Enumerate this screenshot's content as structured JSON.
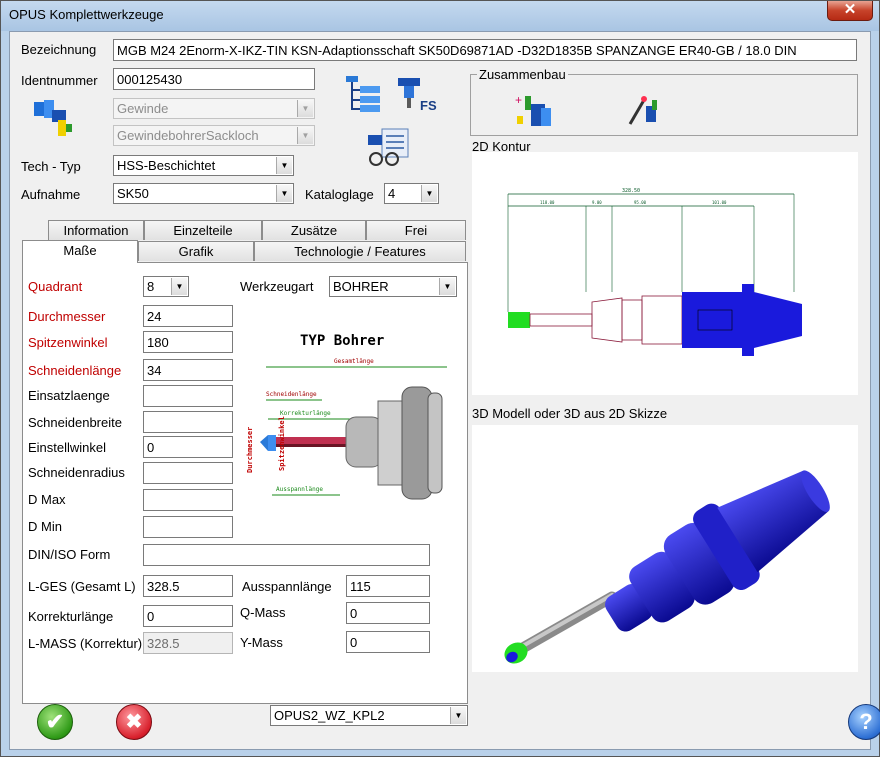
{
  "window": {
    "title": "OPUS Komplettwerkzeuge",
    "close_label": "✕"
  },
  "header": {
    "bezeichnung_label": "Bezeichnung",
    "bezeichnung_value": "MGB M24 2Enorm-X-IKZ-TIN KSN-Adaptionsschaft SK50D69871AD -D32D1835B SPANZANGE ER40-GB / 18.0 DIN",
    "identnummer_label": "Identnummer",
    "identnummer_value": "000125430",
    "gewinde_value": "Gewinde",
    "gewindebohrer_value": "GewindebohrerSackloch",
    "tech_typ_label": "Tech - Typ",
    "tech_typ_value": "HSS-Beschichtet",
    "aufnahme_label": "Aufnahme",
    "aufnahme_value": "SK50",
    "kataloglage_label": "Kataloglage",
    "kataloglage_value": "4"
  },
  "tabs": {
    "row1": [
      "Information",
      "Einzelteile",
      "Zusätze",
      "Frei"
    ],
    "row2": [
      "Maße",
      "Grafik",
      "Technologie / Features"
    ],
    "active": "Maße"
  },
  "masse": {
    "quadrant_label": "Quadrant",
    "quadrant_value": "8",
    "werkzeugart_label": "Werkzeugart",
    "werkzeugart_value": "BOHRER",
    "durchmesser_label": "Durchmesser",
    "durchmesser_value": "24",
    "spitzenwinkel_label": "Spitzenwinkel",
    "spitzenwinkel_value": "180",
    "schneidenlaenge_label": "Schneidenlänge",
    "schneidenlaenge_value": "34",
    "einsatzlaenge_label": "Einsatzlaenge",
    "einsatzlaenge_value": "",
    "schneidenbreite_label": "Schneidenbreite",
    "schneidenbreite_value": "",
    "einstellwinkel_label": "Einstellwinkel",
    "einstellwinkel_value": "0",
    "schneidenradius_label": "Schneidenradius",
    "schneidenradius_value": "",
    "dmax_label": "D Max",
    "dmax_value": "",
    "dmin_label": "D Min",
    "dmin_value": "",
    "diniso_label": "DIN/ISO Form",
    "diniso_value": "",
    "lges_label": "L-GES (Gesamt L)",
    "lges_value": "328.5",
    "ausspann_label": "Ausspannlänge",
    "ausspann_value": "115",
    "korrektur_label": "Korrekturlänge",
    "korrektur_value": "0",
    "qmass_label": "Q-Mass",
    "qmass_value": "0",
    "lmass_label": "L-MASS (Korrektur)",
    "lmass_value": "328.5",
    "ymass_label": "Y-Mass",
    "ymass_value": "0"
  },
  "diagram": {
    "title": "TYP Bohrer",
    "gesamtlaenge": "Gesamtlänge",
    "schneidenlaenge": "Schneidenlänge",
    "korrekturlaenge": "Korrekturlänge",
    "durchmesser": "Durchmesser",
    "spitzenwinkel": "Spitzenwinkel",
    "ausspannlaenge": "Ausspannlänge"
  },
  "right": {
    "zusammenbau_label": "Zusammenbau",
    "kontur_label": "2D Kontur",
    "modell_label": "3D Modell oder 3D aus 2D Skizze",
    "fs_label": "FS"
  },
  "kontur": {
    "dim_total": "328.50",
    "dims": [
      "118.00",
      "9.00",
      "95.00",
      "101.00"
    ]
  },
  "footer": {
    "db_value": "OPUS2_WZ_KPL2",
    "ok_label": "✔",
    "cancel_label": "✖",
    "help_label": "?"
  },
  "colors": {
    "red_label": "#c00000",
    "tool_blue": "#1a1adc",
    "green_tip": "#22dd22"
  },
  "icons": [
    "tool-assembly-icon",
    "tree-list-icon",
    "fs-tool-icon",
    "catalog-list-icon",
    "assembly-build-icon",
    "magic-wand-icon"
  ]
}
